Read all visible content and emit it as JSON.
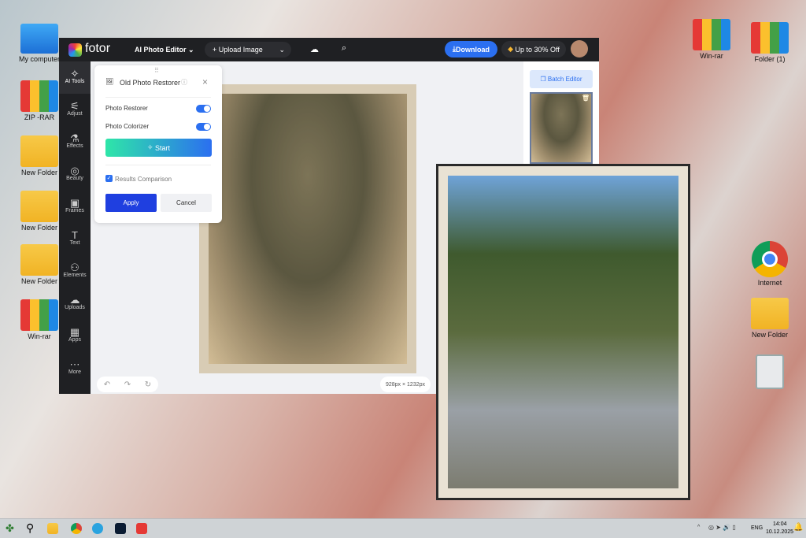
{
  "desktop": {
    "left_icons": [
      "My computer",
      "ZIP -RAR",
      "New Folder",
      "New Folder",
      "New Folder",
      "Win-rar"
    ],
    "right_icons": [
      "Win-rar",
      "Folder (1)",
      "Internet",
      "New Folder"
    ]
  },
  "app": {
    "logo": "fotor",
    "editor_menu": "AI Photo Editor",
    "upload": "Upload Image",
    "download": "Download",
    "promo": "Up to 30% Off",
    "sidebar": [
      "AI Tools",
      "Adjust",
      "Effects",
      "Beauty",
      "Frames",
      "Text",
      "Elements",
      "Uploads",
      "Apps",
      "More"
    ],
    "panel": {
      "title": "Old Photo Restorer",
      "opt1": "Photo Restorer",
      "opt1_on": true,
      "opt2": "Photo Colorizer",
      "opt2_on": true,
      "start": "Start",
      "compare": "Results Comparison",
      "compare_checked": true,
      "apply": "Apply",
      "cancel": "Cancel"
    },
    "batch": "Batch Editor",
    "size": "928px × 1232px"
  },
  "taskbar": {
    "lang": "ENG",
    "time": "14:04",
    "date": "10.12.2025"
  }
}
